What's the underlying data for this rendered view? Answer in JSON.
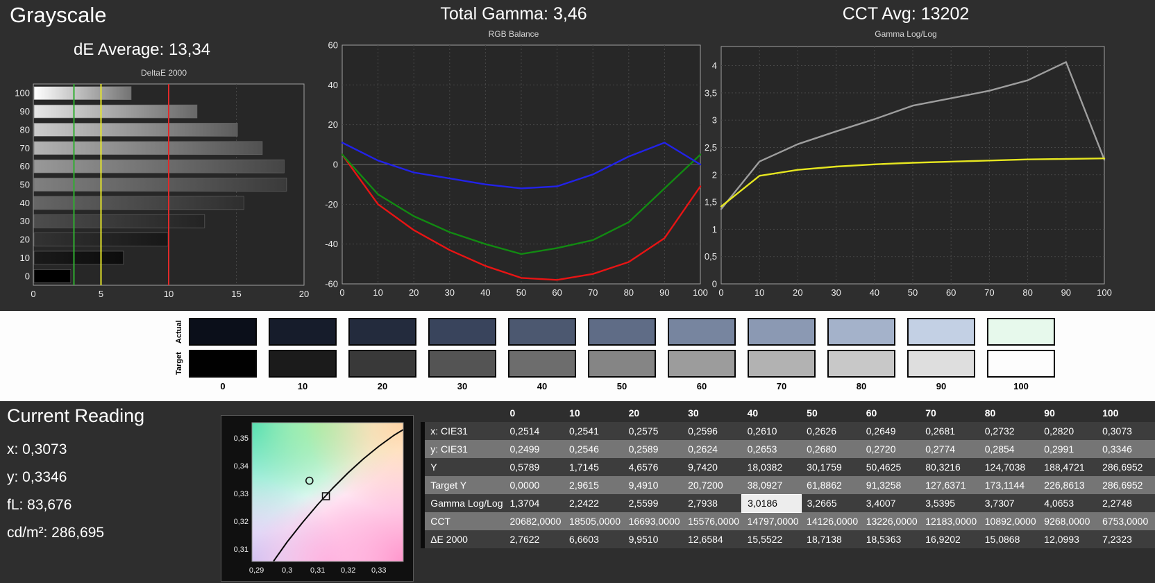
{
  "header": {
    "title": "Grayscale",
    "de_average": "dE Average: 13,34",
    "total_gamma": "Total Gamma: 3,46",
    "cct_avg": "CCT Avg: 13202"
  },
  "chart_data": [
    {
      "type": "bar",
      "orientation": "horizontal",
      "title": "DeltaE 2000",
      "categories": [
        "100",
        "90",
        "80",
        "70",
        "60",
        "50",
        "40",
        "30",
        "20",
        "10",
        "0"
      ],
      "values": [
        7.2323,
        12.0993,
        15.0868,
        16.9202,
        18.5363,
        18.7138,
        15.5522,
        12.6584,
        9.951,
        6.6603,
        2.7622
      ],
      "xlim": [
        0,
        20
      ],
      "x_tick_values": [
        0,
        5,
        10,
        15,
        20
      ],
      "x_tick_labels": [
        "0",
        "5",
        "10",
        "15",
        "20"
      ],
      "reference_lines": [
        {
          "value": 3,
          "color": "#2fae2f",
          "name": "green-reference-line"
        },
        {
          "value": 5,
          "color": "#e6e62a",
          "name": "yellow-reference-line"
        },
        {
          "value": 10,
          "color": "#e02a2a",
          "name": "red-reference-line"
        }
      ]
    },
    {
      "type": "line",
      "title": "RGB Balance",
      "x": [
        0,
        10,
        20,
        30,
        40,
        50,
        60,
        70,
        80,
        90,
        100
      ],
      "x_tick_values": [
        0,
        10,
        20,
        30,
        40,
        50,
        60,
        70,
        80,
        90,
        100
      ],
      "x_tick_labels": [
        "0",
        "10",
        "20",
        "30",
        "40",
        "50",
        "60",
        "70",
        "80",
        "90",
        "100"
      ],
      "ylim": [
        -60,
        60
      ],
      "y_tick_values": [
        -60,
        -40,
        -20,
        0,
        20,
        40,
        60
      ],
      "y_tick_labels": [
        "-60",
        "-40",
        "-20",
        "0",
        "20",
        "40",
        "60"
      ],
      "grid": true,
      "series": [
        {
          "name": "red-balance",
          "color": "#e81414",
          "values": [
            5,
            -20,
            -33,
            -43,
            -51,
            -57,
            -58,
            -55,
            -49,
            -37,
            -11
          ]
        },
        {
          "name": "green-balance",
          "color": "#128a12",
          "values": [
            5,
            -15,
            -26,
            -34,
            -40,
            -45,
            -42,
            -38,
            -29,
            -12,
            5
          ]
        },
        {
          "name": "blue-balance",
          "color": "#2222e8",
          "values": [
            11,
            2,
            -4,
            -7,
            -10,
            -12,
            -11,
            -5,
            4,
            11,
            0
          ]
        }
      ]
    },
    {
      "type": "line",
      "title": "Gamma Log/Log",
      "x": [
        0,
        10,
        20,
        30,
        40,
        50,
        60,
        70,
        80,
        90,
        100
      ],
      "x_tick_values": [
        0,
        10,
        20,
        30,
        40,
        50,
        60,
        70,
        80,
        90,
        100
      ],
      "x_tick_labels": [
        "0",
        "10",
        "20",
        "30",
        "40",
        "50",
        "60",
        "70",
        "80",
        "90",
        "100"
      ],
      "ylim": [
        0,
        4.35
      ],
      "y_tick_values": [
        0,
        0.5,
        1,
        1.5,
        2,
        2.5,
        3,
        3.5,
        4
      ],
      "y_tick_labels": [
        "0",
        "0,5",
        "1",
        "1,5",
        "2",
        "2,5",
        "3",
        "3,5",
        "4"
      ],
      "grid": true,
      "series": [
        {
          "name": "measured-gamma",
          "color": "#9e9e9e",
          "values": [
            1.3704,
            2.2422,
            2.5599,
            2.7938,
            3.0186,
            3.2665,
            3.4007,
            3.5395,
            3.7307,
            4.0653,
            2.2748
          ]
        },
        {
          "name": "target-gamma",
          "color": "#e6e620",
          "values": [
            1.42,
            1.98,
            2.09,
            2.15,
            2.19,
            2.22,
            2.24,
            2.26,
            2.28,
            2.29,
            2.3
          ]
        }
      ]
    },
    {
      "type": "scatter",
      "title": "CIE Chromaticity",
      "xlim": [
        0.2885,
        0.338
      ],
      "ylim": [
        0.3055,
        0.3555
      ],
      "x_tick_values": [
        0.29,
        0.3,
        0.31,
        0.32,
        0.33
      ],
      "x_tick_labels": [
        "0,29",
        "0,3",
        "0,31",
        "0,32",
        "0,33"
      ],
      "y_tick_values": [
        0.31,
        0.32,
        0.33,
        0.34,
        0.35
      ],
      "y_tick_labels": [
        "0,31",
        "0,32",
        "0,33",
        "0,34",
        "0,35"
      ],
      "locus": [
        [
          0.2955,
          0.3055
        ],
        [
          0.3,
          0.3125
        ],
        [
          0.305,
          0.3195
        ],
        [
          0.31,
          0.326
        ],
        [
          0.315,
          0.332
        ],
        [
          0.32,
          0.3375
        ],
        [
          0.325,
          0.3425
        ],
        [
          0.33,
          0.347
        ],
        [
          0.335,
          0.351
        ],
        [
          0.338,
          0.353
        ]
      ],
      "markers": [
        {
          "shape": "circle",
          "x": 0.3073,
          "y": 0.3346,
          "name": "measured-point-marker"
        },
        {
          "shape": "square",
          "x": 0.3127,
          "y": 0.329,
          "name": "target-point-marker"
        }
      ]
    }
  ],
  "swatches": {
    "row_labels": [
      "Actual",
      "Target"
    ],
    "column_labels": [
      "0",
      "10",
      "20",
      "30",
      "40",
      "50",
      "60",
      "70",
      "80",
      "90",
      "100"
    ],
    "actual_colors": [
      "#0b0f1a",
      "#161c2b",
      "#232b3d",
      "#39445c",
      "#4c5870",
      "#5f6c86",
      "#77859f",
      "#8b99b3",
      "#a4b2ca",
      "#c3d0e4",
      "#e7f9ec"
    ],
    "target_colors": [
      "#010101",
      "#1b1b1b",
      "#393939",
      "#545454",
      "#6d6d6d",
      "#858585",
      "#9c9c9c",
      "#b2b2b2",
      "#c8c8c8",
      "#dedede",
      "#fdfdfd"
    ]
  },
  "current_reading": {
    "title": "Current Reading",
    "lines": [
      "x: 0,3073",
      "y: 0,3346",
      "fL: 83,676",
      "cd/m²: 286,695"
    ]
  },
  "table": {
    "column_headers": [
      "",
      "0",
      "10",
      "20",
      "30",
      "40",
      "50",
      "60",
      "70",
      "80",
      "90",
      "100"
    ],
    "rows": [
      {
        "label": "x: CIE31",
        "values": [
          "0,2514",
          "0,2541",
          "0,2575",
          "0,2596",
          "0,2610",
          "0,2626",
          "0,2649",
          "0,2681",
          "0,2732",
          "0,2820",
          "0,3073"
        ]
      },
      {
        "label": "y: CIE31",
        "values": [
          "0,2499",
          "0,2546",
          "0,2589",
          "0,2624",
          "0,2653",
          "0,2680",
          "0,2720",
          "0,2774",
          "0,2854",
          "0,2991",
          "0,3346"
        ]
      },
      {
        "label": "Y",
        "values": [
          "0,5789",
          "1,7145",
          "4,6576",
          "9,7420",
          "18,0382",
          "30,1759",
          "50,4625",
          "80,3216",
          "124,7038",
          "188,4721",
          "286,6952"
        ]
      },
      {
        "label": "Target Y",
        "values": [
          "0,0000",
          "2,9615",
          "9,4910",
          "20,7200",
          "38,0927",
          "61,8862",
          "91,3258",
          "127,6371",
          "173,1144",
          "226,8613",
          "286,6952"
        ]
      },
      {
        "label": "Gamma Log/Log",
        "values": [
          "1,3704",
          "2,2422",
          "2,5599",
          "2,7938",
          "3,0186",
          "3,2665",
          "3,4007",
          "3,5395",
          "3,7307",
          "4,0653",
          "2,2748"
        ]
      },
      {
        "label": "CCT",
        "values": [
          "20682,0000",
          "18505,0000",
          "16693,0000",
          "15576,0000",
          "14797,0000",
          "14126,0000",
          "13226,0000",
          "12183,0000",
          "10892,0000",
          "9268,0000",
          "6753,0000"
        ]
      },
      {
        "label": "ΔE 2000",
        "values": [
          "2,7622",
          "6,6603",
          "9,9510",
          "12,6584",
          "15,5522",
          "18,7138",
          "18,5363",
          "16,9202",
          "15,0868",
          "12,0993",
          "7,2323"
        ]
      }
    ],
    "highlight": {
      "row_index": 4,
      "value_index": 4
    }
  }
}
